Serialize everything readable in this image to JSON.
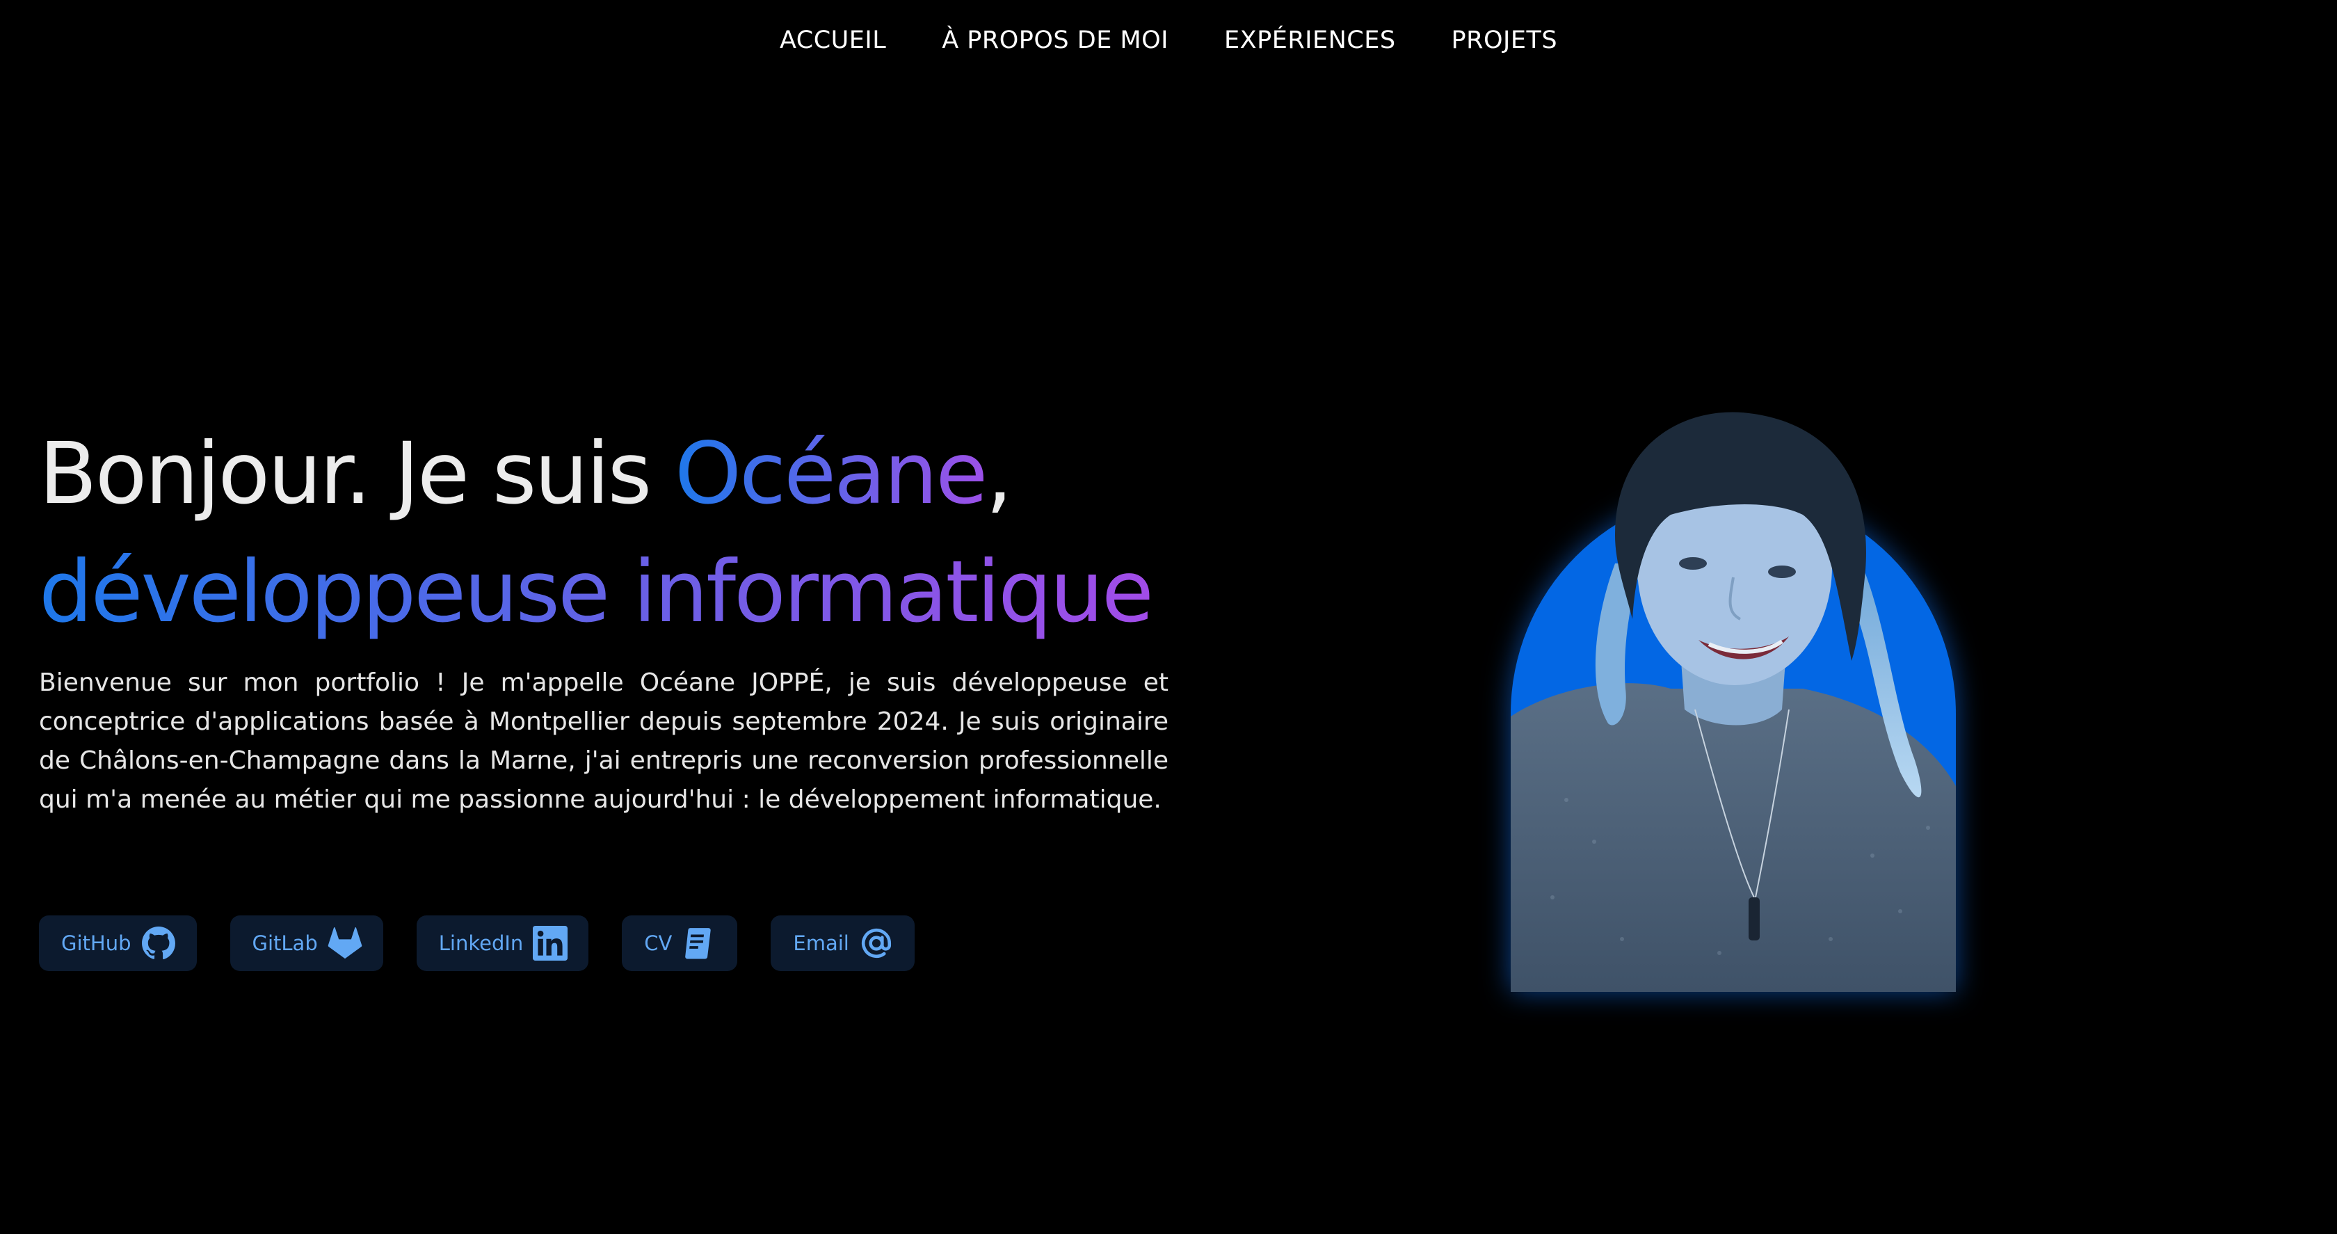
{
  "nav": {
    "items": [
      {
        "label": "ACCUEIL"
      },
      {
        "label": "À PROPOS DE MOI"
      },
      {
        "label": "EXPÉRIENCES"
      },
      {
        "label": "PROJETS"
      }
    ]
  },
  "hero": {
    "greeting": "Bonjour. Je suis ",
    "name": "Océane",
    "comma": ",",
    "role": "développeuse informatique",
    "intro": "Bienvenue sur mon portfolio ! Je m'appelle Océane JOPPÉ, je suis développeuse et conceptrice d'applications basée à Montpellier depuis septembre 2024. Je suis originaire de Châlons-en-Champagne dans la Marne, j'ai entrepris une reconversion professionnelle qui m'a menée au métier qui me passionne aujourd'hui : le développement informatique."
  },
  "links": [
    {
      "label": "GitHub",
      "icon": "github-icon"
    },
    {
      "label": "GitLab",
      "icon": "gitlab-icon"
    },
    {
      "label": "LinkedIn",
      "icon": "linkedin-icon"
    },
    {
      "label": "CV",
      "icon": "document-icon"
    },
    {
      "label": "Email",
      "icon": "at-sign-icon"
    }
  ],
  "colors": {
    "background": "#000000",
    "gradient_start": "#1e78ea",
    "gradient_end": "#a24ce8",
    "button_bg": "#0c1a2e",
    "button_text": "#62a8f4",
    "arch_blue": "#0367e4"
  }
}
